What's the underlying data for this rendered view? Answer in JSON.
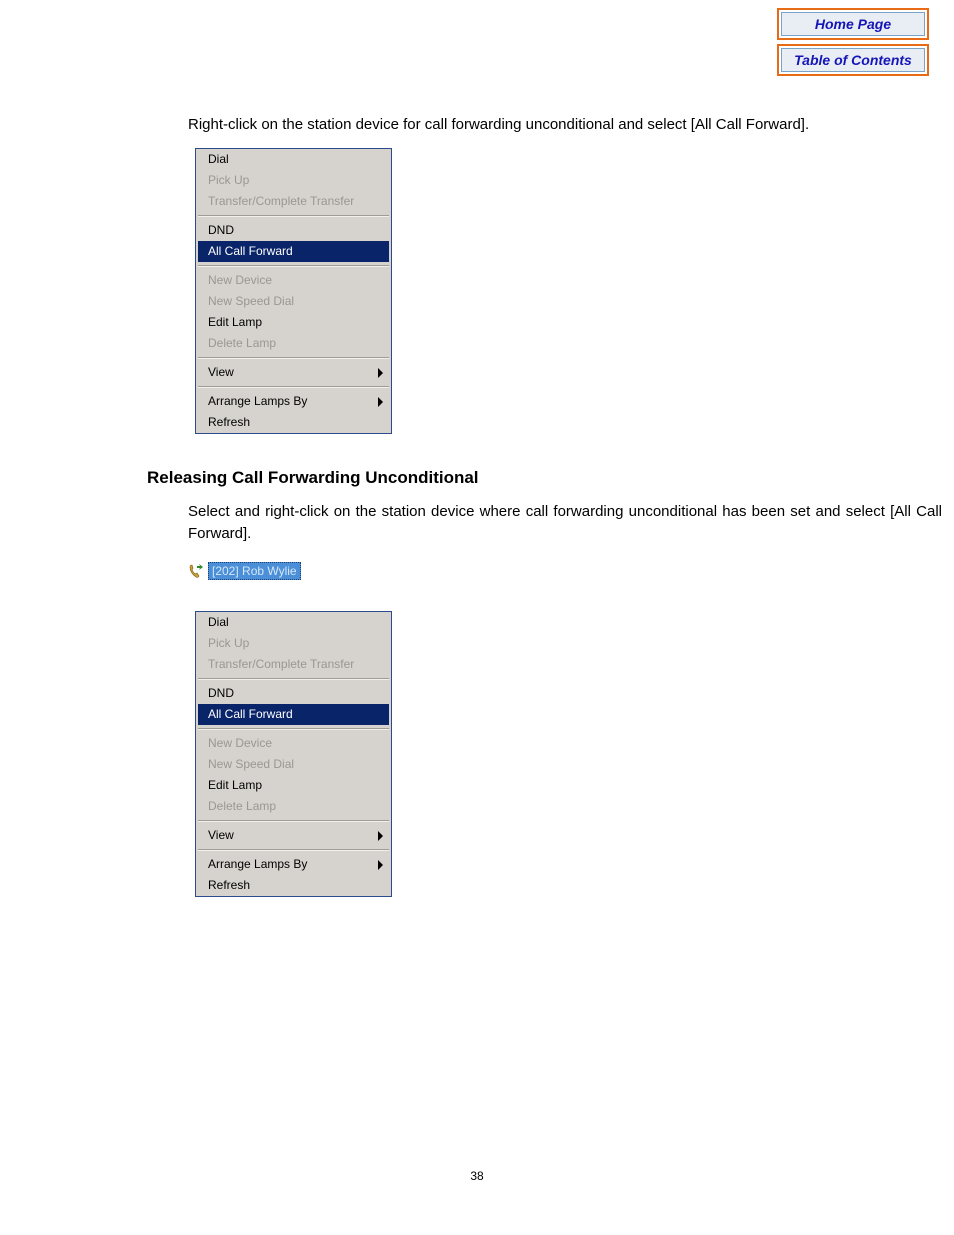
{
  "nav": {
    "home": "Home Page",
    "toc": "Table of Contents"
  },
  "intro_text": "Right-click on the station device for call forwarding unconditional and select [All Call Forward].",
  "heading": "Releasing Call Forwarding Unconditional",
  "release_text": "Select and right-click on the station device where call forwarding unconditional has been set and select [All Call Forward].",
  "station_label": "[202] Rob Wylie",
  "menu": {
    "dial": "Dial",
    "pickup": "Pick Up",
    "transfer": "Transfer/Complete Transfer",
    "dnd": "DND",
    "all_call_forward": "All Call Forward",
    "new_device": "New Device",
    "new_speed_dial": "New Speed Dial",
    "edit_lamp": "Edit Lamp",
    "delete_lamp": "Delete Lamp",
    "view": "View",
    "arrange": "Arrange Lamps By",
    "refresh": "Refresh"
  },
  "page_number": "38"
}
